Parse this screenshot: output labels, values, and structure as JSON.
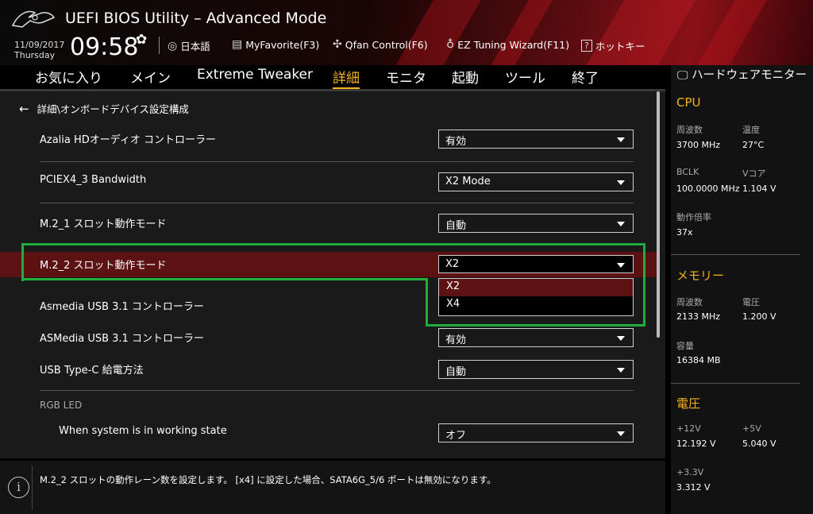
{
  "header": {
    "title": "UEFI BIOS Utility – Advanced Mode",
    "date": "11/09/2017",
    "day": "Thursday",
    "time": "09:58",
    "items": [
      {
        "icon": "globe-icon",
        "label": "日本語"
      },
      {
        "icon": "favorite-icon",
        "label": "MyFavorite(F3)"
      },
      {
        "icon": "fan-icon",
        "label": "Qfan Control(F6)"
      },
      {
        "icon": "bulb-icon",
        "label": "EZ Tuning Wizard(F11)"
      },
      {
        "icon": "help-icon",
        "label": "ホットキー"
      }
    ]
  },
  "tabs": [
    "お気に入り",
    "メイン",
    "Extreme Tweaker",
    "詳細",
    "モニタ",
    "起動",
    "ツール",
    "終了"
  ],
  "active_tab": "詳細",
  "breadcrumb": "詳細\\オンボードデバイス設定構成",
  "settings": [
    {
      "label": "Azalia HDオーディオ コントローラー",
      "value": "有効"
    },
    {
      "label": "PCIEX4_3 Bandwidth",
      "value": "X2 Mode"
    },
    {
      "label": "M.2_1 スロット動作モード",
      "value": "自動"
    },
    {
      "label": "M.2_2 スロット動作モード",
      "value": "X2"
    },
    {
      "label": "Asmedia USB 3.1 コントローラー",
      "value": ""
    },
    {
      "label": "ASMedia USB 3.1 コントローラー",
      "value": "有効"
    },
    {
      "label": "USB Type-C 給電方法",
      "value": "自動"
    },
    {
      "label": "When system is in working state",
      "value": "オフ"
    }
  ],
  "section_rgb": "RGB LED",
  "dropdown_options": [
    "X2",
    "X4"
  ],
  "help_text": "M.2_2 スロットの動作レーン数を設定します。 [x4] に設定した場合、SATA6G_5/6 ポートは無効になります。",
  "monitor": {
    "title": "ハードウェアモニター",
    "cpu": {
      "heading": "CPU",
      "freq_label": "周波数",
      "freq": "3700 MHz",
      "temp_label": "温度",
      "temp": "27°C",
      "bclk_label": "BCLK",
      "bclk": "100.0000 MHz",
      "vcore_label": "Vコア",
      "vcore": "1.104 V",
      "ratio_label": "動作倍率",
      "ratio": "37x"
    },
    "memory": {
      "heading": "メモリー",
      "freq_label": "周波数",
      "freq": "2133 MHz",
      "volt_label": "電圧",
      "volt": "1.200 V",
      "cap_label": "容量",
      "cap": "16384 MB"
    },
    "voltage": {
      "heading": "電圧",
      "v12_label": "+12V",
      "v12": "12.192 V",
      "v5_label": "+5V",
      "v5": "5.040 V",
      "v33_label": "+3.3V",
      "v33": "3.312 V"
    }
  },
  "colors": {
    "accent": "#f2b31c",
    "highlight": "#5c1212",
    "annotation": "#1fae3c"
  }
}
